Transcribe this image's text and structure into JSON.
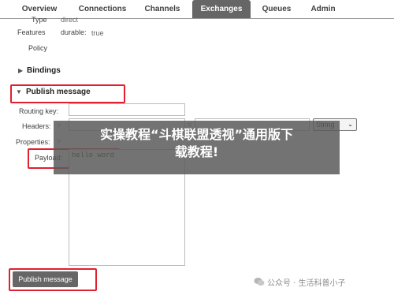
{
  "nav": {
    "tabs": [
      {
        "label": "Overview"
      },
      {
        "label": "Connections"
      },
      {
        "label": "Channels"
      },
      {
        "label": "Exchanges"
      },
      {
        "label": "Queues"
      },
      {
        "label": "Admin"
      }
    ],
    "active_tab": "Exchanges"
  },
  "details": {
    "type_label": "Type",
    "type_value": "direct",
    "features_label": "Features",
    "features_key": "durable:",
    "features_value": "true",
    "policy_label": "Policy"
  },
  "bindings": {
    "label": "Bindings"
  },
  "publish": {
    "section_label": "Publish message",
    "routing_key_label": "Routing key:",
    "headers_label": "Headers:",
    "headers_help": "?",
    "headers_eq": "=",
    "headers_type": "String",
    "properties_label": "Properties:",
    "properties_help": "?",
    "payload_label": "Payload:",
    "payload_value": "hello word",
    "button_label": "Publish message"
  },
  "overlay": {
    "line1": "实操教程“斗棋联盟透视”通用版下",
    "line2": "载教程!"
  },
  "watermark": {
    "text": "公众号 · 生活科普小子"
  },
  "colors": {
    "highlight": "#e0202e",
    "tab_active_bg": "#666666"
  }
}
